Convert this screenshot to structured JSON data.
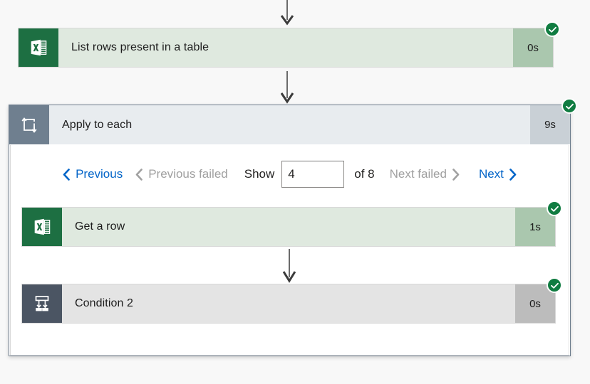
{
  "colors": {
    "page_background": "#f8f8f8",
    "success_card": "#dfe9df",
    "success_icon": "#1d6f42",
    "success_duration": "#aac7ae",
    "neutral_card": "#e4e4e4",
    "neutral_icon": "#4b5563",
    "neutral_duration": "#bcbcbc",
    "scope_header": "#e8ecef",
    "scope_icon": "#6f7f8f",
    "scope_duration": "#c9d0d6",
    "scope_border": "#6f7f8f",
    "status_success": "#107c41",
    "link_enabled": "#0264c8",
    "link_disabled": "#a0a0a0",
    "connector": "#6b6b6b"
  },
  "flow": {
    "top_action": {
      "title": "List rows present in a table",
      "duration": "0s",
      "icon": "excel-icon",
      "status": "succeeded",
      "status_icon": "check-circle-icon"
    },
    "scope": {
      "title": "Apply to each",
      "duration": "9s",
      "icon": "foreach-loop-icon",
      "status": "succeeded",
      "status_icon": "check-circle-icon",
      "pager": {
        "previous_label": "Previous",
        "previous_icon": "chevron-left-icon",
        "previous_enabled": true,
        "previous_failed_label": "Previous failed",
        "previous_failed_icon": "chevron-left-icon",
        "previous_failed_enabled": false,
        "show_label": "Show",
        "show_value": "4",
        "show_placeholder": "",
        "of_label": "of 8",
        "total": "8",
        "next_failed_label": "Next failed",
        "next_failed_icon": "chevron-right-icon",
        "next_failed_enabled": false,
        "next_label": "Next",
        "next_icon": "chevron-right-icon",
        "next_enabled": true
      },
      "actions": [
        {
          "title": "Get a row",
          "duration": "1s",
          "icon": "excel-icon",
          "status": "succeeded",
          "status_icon": "check-circle-icon"
        },
        {
          "title": "Condition 2",
          "duration": "0s",
          "icon": "condition-branch-icon",
          "status": "succeeded",
          "status_icon": "check-circle-icon"
        }
      ]
    }
  }
}
